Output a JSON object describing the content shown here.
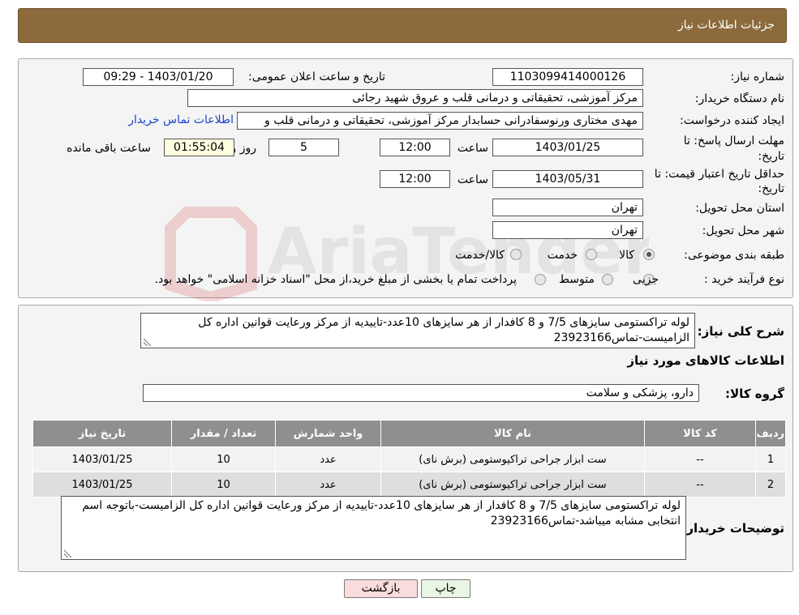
{
  "header": {
    "title": "جزئیات اطلاعات نیاز"
  },
  "watermark": {
    "text": "AriaTender.neT"
  },
  "info": {
    "need_number_label": "شماره نیاز:",
    "need_number": "1103099414000126",
    "announce_label": "تاریخ و ساعت اعلان عمومی:",
    "announce_value": "1403/01/20 - 09:29",
    "buyer_org_label": "نام دستگاه خریدار:",
    "buyer_org": "مرکز آموزشی، تحقیقاتی و درمانی قلب و عروق شهید رجائی",
    "creator_label": "ایجاد کننده درخواست:",
    "creator": "مهدی مختاری ورنوسفادرانی حسابدار مرکز آموزشی، تحقیقاتی و درمانی قلب و",
    "contact_link": "اطلاعات تماس خریدار",
    "deadline_label_1": "مهلت ارسال پاسخ: تا",
    "deadline_label_2": "تاریخ:",
    "deadline_date": "1403/01/25",
    "time_label": "ساعت",
    "deadline_time": "12:00",
    "days_value": "5",
    "days_label": "روز و",
    "remaining_time": "01:55:04",
    "remaining_label": "ساعت باقی مانده",
    "validity_label_1": "حداقل تاریخ اعتبار قیمت: تا",
    "validity_label_2": "تاریخ:",
    "validity_date": "1403/05/31",
    "validity_time": "12:00",
    "province_label": "استان محل تحویل:",
    "province": "تهران",
    "city_label": "شهر محل تحویل:",
    "city": "تهران",
    "category_label": "طبقه بندی موضوعی:",
    "category_options": [
      "کالا",
      "خدمت",
      "کالا/خدمت"
    ],
    "category_selected": "کالا",
    "process_label": "نوع فرآیند خرید :",
    "process_options": [
      "جزیی",
      "متوسط"
    ],
    "process_note": "پرداخت تمام یا بخشی از مبلغ خرید،از محل \"اسناد خزانه اسلامی\" خواهد بود."
  },
  "description": {
    "label": "شرح کلی نیاز:",
    "text": "لوله تراکستومی سایزهای 7/5 و 8 کافدار از هر سایزهای 10عدد-تاییدیه از مرکز ورعایت قوانین اداره کل الزامیست-تماس23923166"
  },
  "goods": {
    "section_title": "اطلاعات کالاهای مورد نیاز",
    "group_label": "گروه کالا:",
    "group_value": "دارو، پزشکی و سلامت",
    "columns": [
      "ردیف",
      "کد کالا",
      "نام کالا",
      "واحد شمارش",
      "تعداد / مقدار",
      "تاریخ نیاز"
    ],
    "rows": [
      [
        "1",
        "--",
        "ست ابزار جراحی تراکیوستومی (برش نای)",
        "عدد",
        "10",
        "1403/01/25"
      ],
      [
        "2",
        "--",
        "ست ابزار جراحی تراکیوستومی (برش نای)",
        "عدد",
        "10",
        "1403/01/25"
      ]
    ]
  },
  "buyer_notes": {
    "label": "توضیحات خریدار:",
    "text": "لوله تراکستومی سایزهای 7/5 و 8 کافدار از هر سایزهای 10عدد-تاییدیه از مرکز ورعایت قوانین اداره کل الزامیست-باتوجه اسم انتخابی مشابه میباشد-تماس23923166"
  },
  "buttons": {
    "print": "چاپ",
    "back": "بازگشت"
  }
}
